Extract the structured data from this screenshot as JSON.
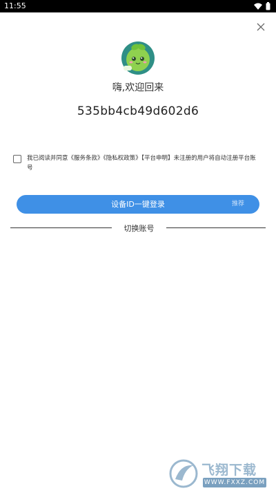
{
  "status_bar": {
    "time": "11:55"
  },
  "close_icon": "close-icon",
  "avatar_icon": "sprout-mascot-avatar",
  "greeting": "嗨,欢迎回来",
  "device_id": "535bb4cb49d602d6",
  "agreement": {
    "prefix": "我已阅读并同意",
    "terms": "《服务条款》",
    "privacy": "《隐私权政策》",
    "platform": "【平台申明】",
    "suffix": "未注册的用户将自动注册平台账号",
    "checked": false
  },
  "login_button": {
    "label": "设备ID一键登录",
    "badge": "推荐"
  },
  "switch_account": "切换账号",
  "watermark": {
    "title": "飞翔下载",
    "url": "WWW.FXXZ.COM"
  },
  "colors": {
    "primary": "#3f90e6",
    "background": "#ffffff"
  }
}
